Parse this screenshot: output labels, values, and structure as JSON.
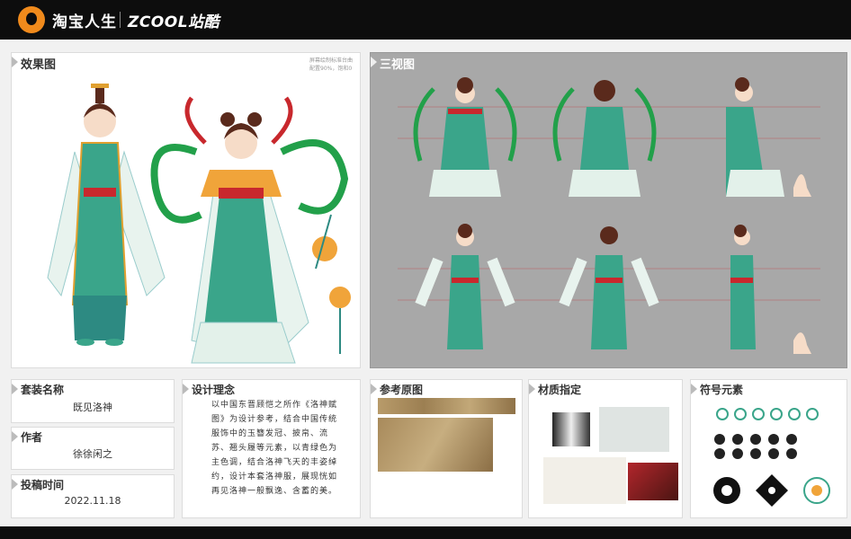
{
  "header": {
    "brand_taobao": "淘宝人生",
    "brand_zcool": "ZCOOL站酷"
  },
  "effect_panel": {
    "title": "效果图",
    "note": "屏幕绘制标准台曲 配置90%，饱和0"
  },
  "three_view_panel": {
    "title": "三视图"
  },
  "info": {
    "set_name_label": "套装名称",
    "set_name_value": "既见洛神",
    "author_label": "作者",
    "author_value": "徐徐闲之",
    "date_label": "投稿时间",
    "date_value": "2022.11.18"
  },
  "concept": {
    "title": "设计理念",
    "text": "以中国东晋顾恺之所作《洛神赋图》为设计参考，结合中国传统服饰中的玉簪发冠、披帛、流苏、翘头履等元素，以青绿色为主色调，结合洛神飞天的丰姿绰约，设计本套洛神服，展现恍如再见洛神一般飘逸、含蓄的美。"
  },
  "reference": {
    "title": "参考原图"
  },
  "material": {
    "title": "材质指定"
  },
  "symbol": {
    "title": "符号元素"
  },
  "colors": {
    "teal": "#3aa58a",
    "mint": "#d7ebe0",
    "red": "#c8282d",
    "green": "#22a04a",
    "gold": "#f0a43a",
    "gray_bg": "#a8a8a8"
  }
}
